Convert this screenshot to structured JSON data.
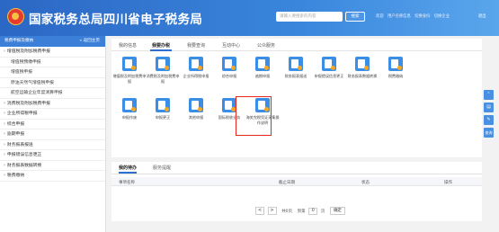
{
  "header": {
    "title": "国家税务总局四川省电子税务局",
    "search_placeholder": "请输入要搜索的内容",
    "search_button": "搜索",
    "user_links": [
      "欢迎",
      "用户名称信息",
      "切换身份",
      "切换企业"
    ],
    "logout": "退出"
  },
  "sidebar": {
    "title": "税费申报及缴纳",
    "back_label": "« 返回主页",
    "items": [
      {
        "label": "增值税及附加税费申报",
        "level": "top"
      },
      {
        "label": "增值税预缴申报",
        "level": "sub"
      },
      {
        "label": "增值税申报",
        "level": "sub"
      },
      {
        "label": "原油天然气增值税申报",
        "level": "sub"
      },
      {
        "label": "航空运输企业年度清算申报",
        "level": "sub"
      },
      {
        "label": "消费税及附加税费申报",
        "level": "top"
      },
      {
        "label": "企业所得税申报",
        "level": "top"
      },
      {
        "label": "综合申报",
        "level": "top"
      },
      {
        "label": "逾期申报",
        "level": "top"
      },
      {
        "label": "财务报表报送",
        "level": "top"
      },
      {
        "label": "申报错误信息更正",
        "level": "top"
      },
      {
        "label": "财务报表数据转换",
        "level": "top"
      },
      {
        "label": "税费缴纳",
        "level": "top"
      }
    ]
  },
  "main": {
    "tabs": [
      {
        "label": "我的信息",
        "active": false
      },
      {
        "label": "我要办税",
        "active": true
      },
      {
        "label": "我要查询",
        "active": false
      },
      {
        "label": "互动中心",
        "active": false
      },
      {
        "label": "公众服务",
        "active": false
      }
    ],
    "grid_row1": [
      {
        "label": "增值税及附加税费申报",
        "icon": "document-tax-icon"
      },
      {
        "label": "消费税及附加税费申报",
        "icon": "document-tax-icon"
      },
      {
        "label": "企业所得税申报",
        "icon": "document-tax-icon"
      },
      {
        "label": "综合申报",
        "icon": "document-tax-icon"
      },
      {
        "label": "逾期申报",
        "icon": "document-tax-icon"
      },
      {
        "label": "财务报表报送",
        "icon": "document-tax-icon"
      },
      {
        "label": "申报错误信息更正",
        "icon": "document-tax-icon"
      },
      {
        "label": "财务报表数据转换",
        "icon": "document-tax-icon"
      },
      {
        "label": "税费缴纳",
        "icon": "document-tax-icon"
      }
    ],
    "grid_row2": [
      {
        "label": "申报作废",
        "icon": "document-tax-icon"
      },
      {
        "label": "申报更正",
        "icon": "document-tax-icon"
      },
      {
        "label": "其他申报",
        "icon": "document-tax-icon"
      },
      {
        "label": "国际税收业务",
        "icon": "document-tax-icon",
        "highlighted": true
      },
      {
        "label": "海关完税凭证采集操作说明",
        "icon": "document-tax-icon"
      }
    ],
    "highlight_color": "#e8261c"
  },
  "pending": {
    "tabs": [
      {
        "label": "我的待办",
        "active": true
      },
      {
        "label": "服务提醒",
        "active": false
      }
    ],
    "columns": [
      "事项名称",
      "截止日期",
      "状态",
      "操作"
    ],
    "pager": {
      "prev": "<",
      "next": ">",
      "total_text": "共0页",
      "goto_text": "到第",
      "page_value": "0",
      "page_unit": "页",
      "confirm": "确定"
    }
  },
  "tools": [
    {
      "symbol": "⌃",
      "icon": "scroll-top-icon"
    },
    {
      "symbol": "▤",
      "icon": "list-icon"
    },
    {
      "symbol": "✎",
      "icon": "edit-icon"
    },
    {
      "symbol": "查询",
      "icon": "query-icon"
    }
  ]
}
